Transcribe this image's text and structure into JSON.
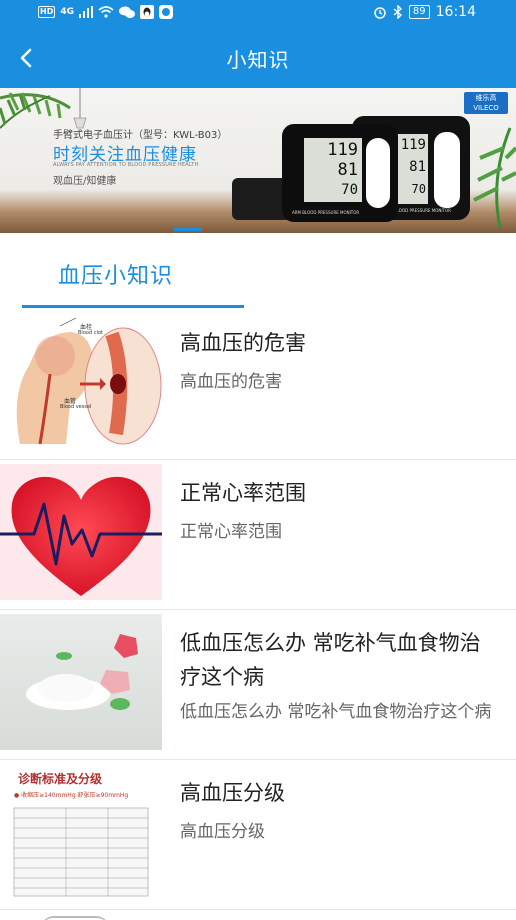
{
  "status_bar": {
    "left_badge": "HD",
    "network": "4G",
    "time": "16:14",
    "battery": "89"
  },
  "header": {
    "title": "小知识",
    "back_icon": "chevron-left-icon"
  },
  "banner": {
    "product_line": "手臂式电子血压计（型号：KWL-B03）",
    "headline": "时刻关注血压健康",
    "english_line": "ALWAYS PAY ATTENTION TO BLOOD PRESSURE HEALTH",
    "tagline": "观血压/知健康",
    "brand": "维乐高",
    "brand_en": "VILECO",
    "device_front": {
      "sys": "119",
      "dia": "81",
      "pulse": "70",
      "label": "ARM BLOOD PRESSURE MONITOR"
    },
    "device_back": {
      "sys": "119",
      "dia": "81",
      "pulse": "70",
      "label": "BLOOD PRESSURE MONITOR"
    }
  },
  "section_tab": {
    "label": "血压小知识"
  },
  "articles": [
    {
      "title": "高血压的危害",
      "summary": "高血压的危害",
      "thumb_labels": [
        "血栓",
        "Blood clot",
        "血管",
        "Blood vessel"
      ]
    },
    {
      "title": "正常心率范围",
      "summary": "正常心率范围"
    },
    {
      "title": "低血压怎么办 常吃补气血食物治疗这个病",
      "summary": "低血压怎么办 常吃补气血食物治疗这个病"
    },
    {
      "title": "高血压分级",
      "summary": "高血压分级",
      "thumb_labels": [
        "诊断标准及分级",
        "● 收缩压≥140mmHg  舒张压≥90mmHg"
      ]
    }
  ],
  "colors": {
    "primary": "#1a8fe0",
    "text_primary": "#222222",
    "text_secondary": "#666666"
  }
}
